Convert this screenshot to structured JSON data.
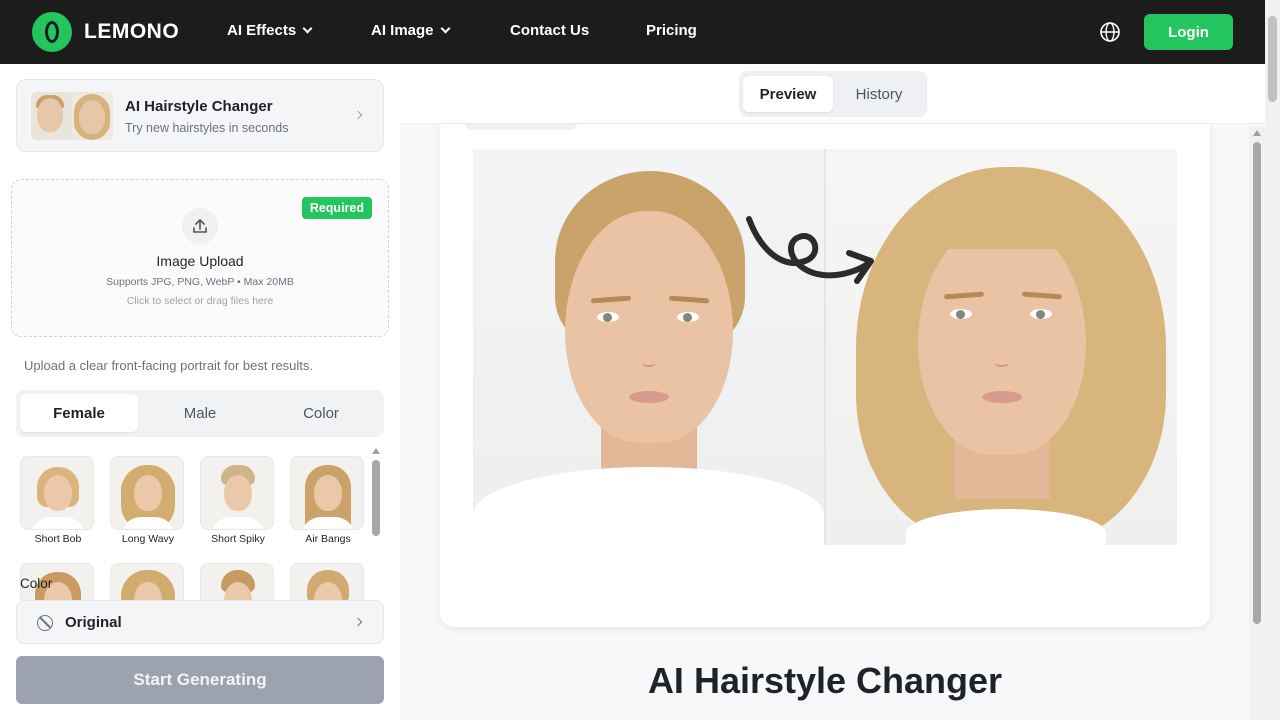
{
  "brand": {
    "name": "LEMONO",
    "accent": "#22c55e"
  },
  "nav": {
    "items": [
      {
        "label": "AI Effects",
        "has_dropdown": true
      },
      {
        "label": "AI Image",
        "has_dropdown": true
      },
      {
        "label": "Contact Us",
        "has_dropdown": false
      },
      {
        "label": "Pricing",
        "has_dropdown": false
      }
    ],
    "language_icon": "globe-icon",
    "login_label": "Login"
  },
  "tool_card": {
    "title": "AI Hairstyle Changer",
    "subtitle": "Try new hairstyles in seconds"
  },
  "upload": {
    "badge": "Required",
    "title": "Image Upload",
    "formats": "Supports JPG, PNG, WebP • Max 20MB",
    "hint": "Click to select or drag files here"
  },
  "tip": "Upload a clear front-facing portrait for best results.",
  "style_tabs": [
    {
      "label": "Female",
      "active": true
    },
    {
      "label": "Male",
      "active": false
    },
    {
      "label": "Color",
      "active": false
    }
  ],
  "styles": [
    {
      "label": "Short Bob"
    },
    {
      "label": "Long Wavy"
    },
    {
      "label": "Short Spiky"
    },
    {
      "label": "Air Bangs"
    },
    {
      "label": ""
    },
    {
      "label": ""
    },
    {
      "label": ""
    },
    {
      "label": ""
    }
  ],
  "color_section": {
    "label": "Color",
    "selected": "Original"
  },
  "generate_label": "Start Generating",
  "preview_tabs": [
    {
      "label": "Preview",
      "active": true
    },
    {
      "label": "History",
      "active": false
    }
  ],
  "hero_title": "AI Hairstyle Changer"
}
